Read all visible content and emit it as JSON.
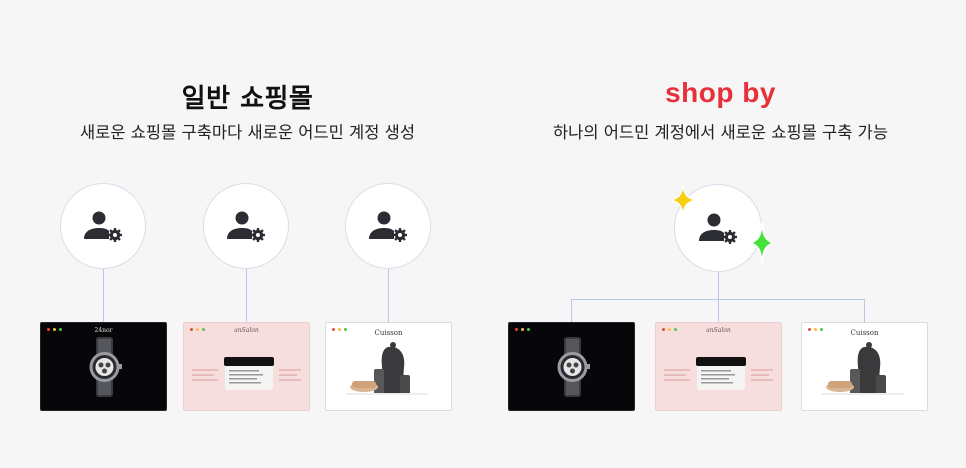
{
  "left": {
    "title": "일반 쇼핑몰",
    "subtitle": "새로운 쇼핑몰 구축마다 새로운 어드민 계정 생성"
  },
  "right": {
    "title": "shop by",
    "subtitle": "하나의 어드민 계정에서 새로운 쇼핑몰 구축 가능"
  },
  "thumbs": {
    "watch_brand": "24nor",
    "cosmetic_brand": "anSalon",
    "kitchen_brand": "Cuisson"
  },
  "colors": {
    "brand_red": "#e8303a",
    "connector": "#b9c8e4",
    "icon": "#2b2d33",
    "sparkle_yellow": "#f5cf10",
    "sparkle_green": "#46e23c"
  },
  "icons": {
    "admin": "user-gear-icon",
    "sparkle": "sparkle-icon"
  }
}
